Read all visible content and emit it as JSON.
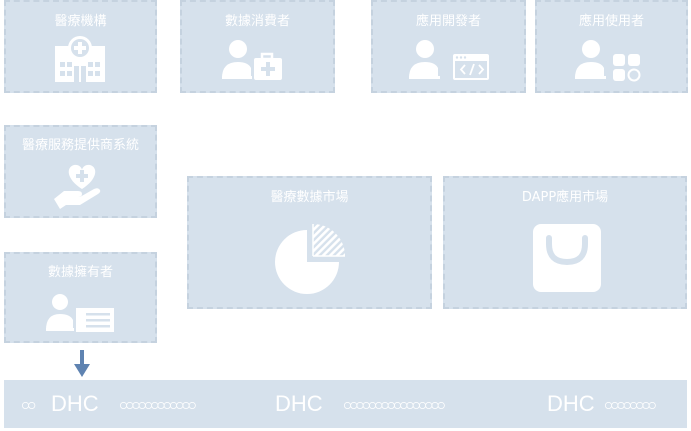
{
  "nodes": {
    "medical_institution": "醫療機構",
    "data_consumer": "數據消費者",
    "app_developer": "應用開發者",
    "app_user": "應用使用者",
    "service_provider_system": "醫療服務提供商系統",
    "data_owner": "數據擁有者",
    "data_market": "醫療數據市場",
    "dapp_market": "DAPP應用市場"
  },
  "chain": {
    "label_1": "DHC",
    "label_2": "DHC",
    "label_3": "DHC",
    "links_1": "ထ",
    "links_2": "ထထထထထထ",
    "links_3": "ထထထထထထထထ",
    "links_4": "ထထထထ"
  },
  "colors": {
    "box_fill": "#d6e1ec",
    "box_border": "#c5d2df",
    "text": "#ffffff",
    "arrow": "#5f83b1"
  }
}
